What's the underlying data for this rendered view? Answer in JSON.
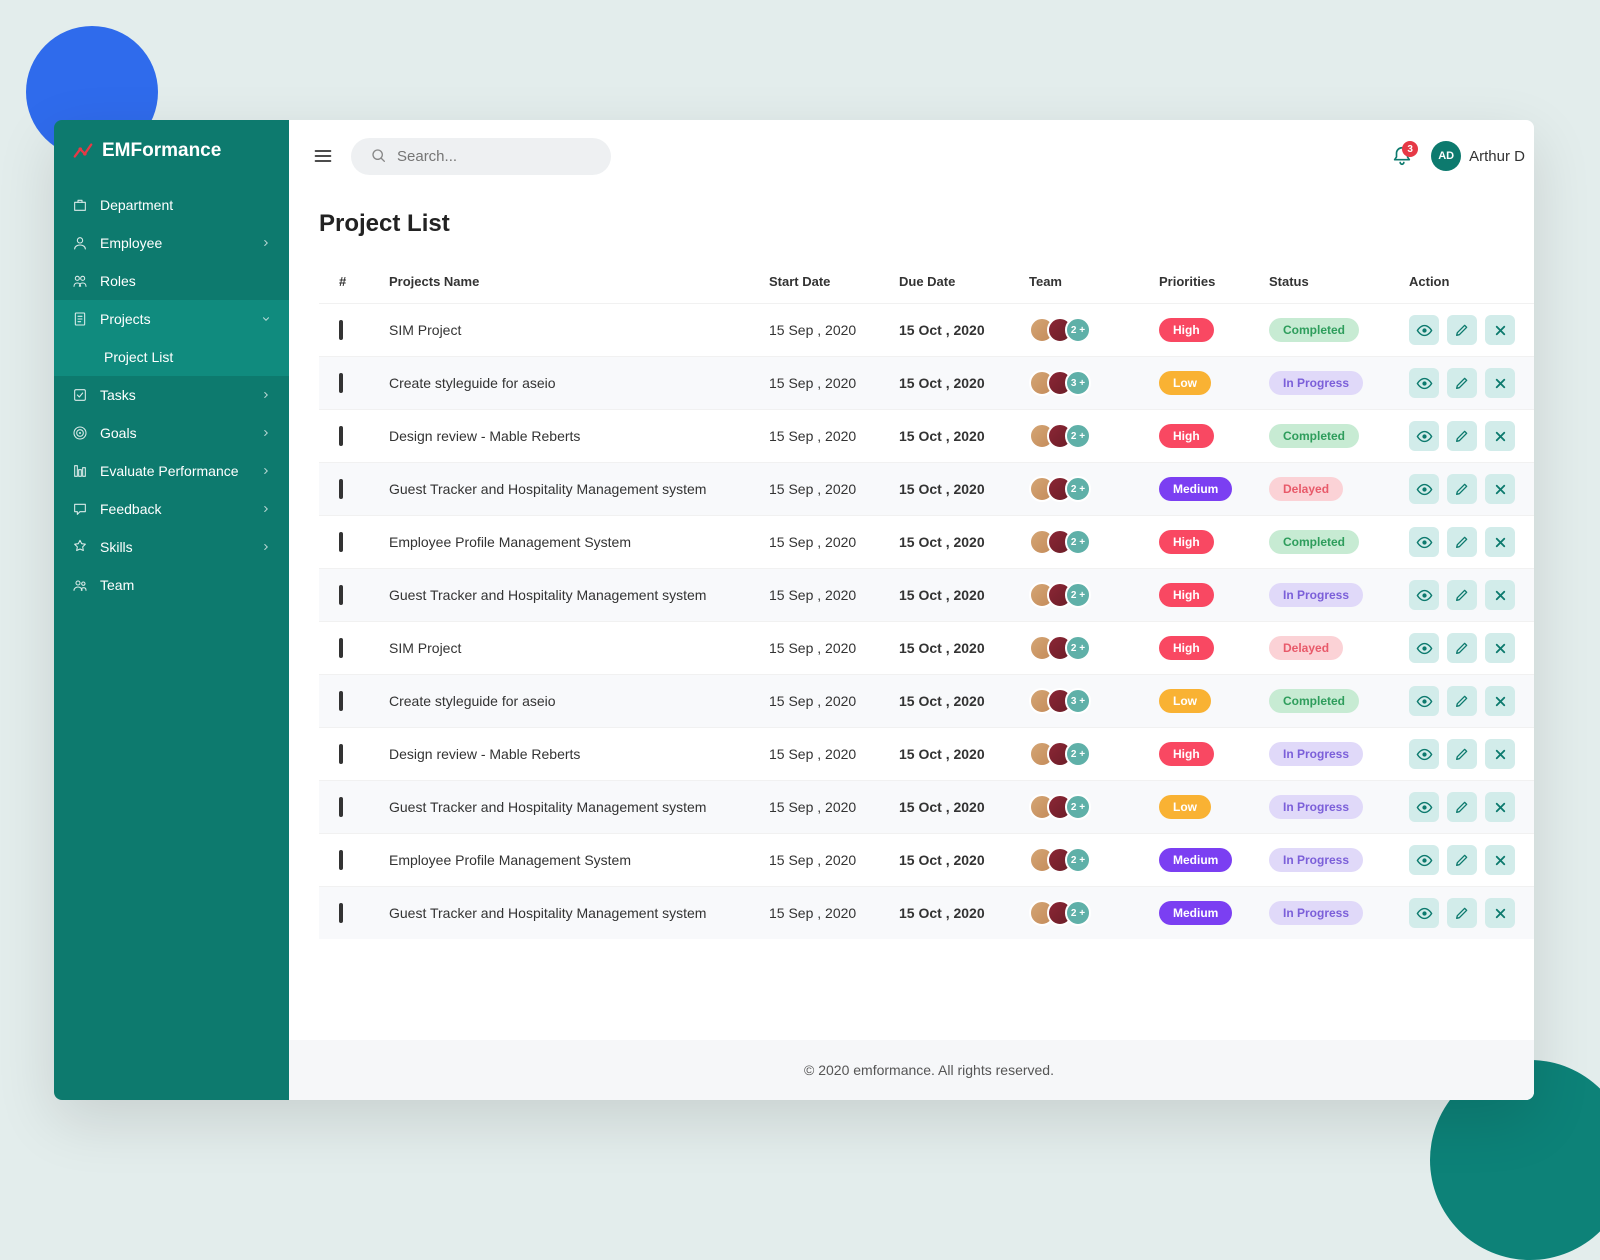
{
  "brand": {
    "name": "EMFormance"
  },
  "header": {
    "search_placeholder": "Search...",
    "notif_count": "3",
    "user_initials": "AD",
    "user_name": "Arthur D"
  },
  "sidebar": {
    "items": [
      {
        "label": "Department",
        "icon": "department"
      },
      {
        "label": "Employee",
        "icon": "employee",
        "expandable": true
      },
      {
        "label": "Roles",
        "icon": "roles"
      },
      {
        "label": "Projects",
        "icon": "projects",
        "expandable": true,
        "active": true
      },
      {
        "label": "Tasks",
        "icon": "tasks",
        "expandable": true
      },
      {
        "label": "Goals",
        "icon": "goals",
        "expandable": true
      },
      {
        "label": "Evaluate Performance",
        "icon": "evaluate",
        "expandable": true
      },
      {
        "label": "Feedback",
        "icon": "feedback",
        "expandable": true
      },
      {
        "label": "Skills",
        "icon": "skills",
        "expandable": true
      },
      {
        "label": "Team",
        "icon": "team"
      }
    ],
    "sub_item": "Project List"
  },
  "page": {
    "title": "Project List"
  },
  "table": {
    "headers": {
      "check": "#",
      "name": "Projects Name",
      "start": "Start Date",
      "due": "Due Date",
      "team": "Team",
      "priority": "Priorities",
      "status": "Status",
      "action": "Action"
    },
    "rows": [
      {
        "name": "SIM Project",
        "start": "15 Sep , 2020",
        "due": "15 Oct , 2020",
        "more": "2 +",
        "priority": "High",
        "pclass": "pri-high",
        "status": "Completed",
        "sclass": "stat-completed"
      },
      {
        "name": "Create styleguide for aseio",
        "start": "15 Sep , 2020",
        "due": "15 Oct , 2020",
        "more": "3 +",
        "priority": "Low",
        "pclass": "pri-low",
        "status": "In Progress",
        "sclass": "stat-inprogress"
      },
      {
        "name": "Design review - Mable Reberts",
        "start": "15 Sep , 2020",
        "due": "15 Oct , 2020",
        "more": "2 +",
        "priority": "High",
        "pclass": "pri-high",
        "status": "Completed",
        "sclass": "stat-completed"
      },
      {
        "name": "Guest Tracker and Hospitality Management system",
        "start": "15 Sep , 2020",
        "due": "15 Oct , 2020",
        "more": "2 +",
        "priority": "Medium",
        "pclass": "pri-medium",
        "status": "Delayed",
        "sclass": "stat-delayed"
      },
      {
        "name": "Employee Profile Management System",
        "start": "15 Sep , 2020",
        "due": "15 Oct , 2020",
        "more": "2 +",
        "priority": "High",
        "pclass": "pri-high",
        "status": "Completed",
        "sclass": "stat-completed"
      },
      {
        "name": "Guest Tracker and Hospitality Management system",
        "start": "15 Sep , 2020",
        "due": "15 Oct , 2020",
        "more": "2 +",
        "priority": "High",
        "pclass": "pri-high",
        "status": "In Progress",
        "sclass": "stat-inprogress"
      },
      {
        "name": "SIM Project",
        "start": "15 Sep , 2020",
        "due": "15 Oct , 2020",
        "more": "2 +",
        "priority": "High",
        "pclass": "pri-high",
        "status": "Delayed",
        "sclass": "stat-delayed"
      },
      {
        "name": "Create styleguide for aseio",
        "start": "15 Sep , 2020",
        "due": "15 Oct , 2020",
        "more": "3 +",
        "priority": "Low",
        "pclass": "pri-low",
        "status": "Completed",
        "sclass": "stat-completed"
      },
      {
        "name": "Design review - Mable Reberts",
        "start": "15 Sep , 2020",
        "due": "15 Oct , 2020",
        "more": "2 +",
        "priority": "High",
        "pclass": "pri-high",
        "status": "In Progress",
        "sclass": "stat-inprogress"
      },
      {
        "name": "Guest Tracker and Hospitality Management system",
        "start": "15 Sep , 2020",
        "due": "15 Oct , 2020",
        "more": "2 +",
        "priority": "Low",
        "pclass": "pri-low",
        "status": "In Progress",
        "sclass": "stat-inprogress"
      },
      {
        "name": "Employee Profile Management System",
        "start": "15 Sep , 2020",
        "due": "15 Oct , 2020",
        "more": "2 +",
        "priority": "Medium",
        "pclass": "pri-medium",
        "status": "In Progress",
        "sclass": "stat-inprogress"
      },
      {
        "name": "Guest Tracker and Hospitality Management system",
        "start": "15 Sep , 2020",
        "due": "15 Oct , 2020",
        "more": "2 +",
        "priority": "Medium",
        "pclass": "pri-medium",
        "status": "In Progress",
        "sclass": "stat-inprogress"
      }
    ]
  },
  "footer": {
    "text": "© 2020 emformance. All rights reserved."
  }
}
